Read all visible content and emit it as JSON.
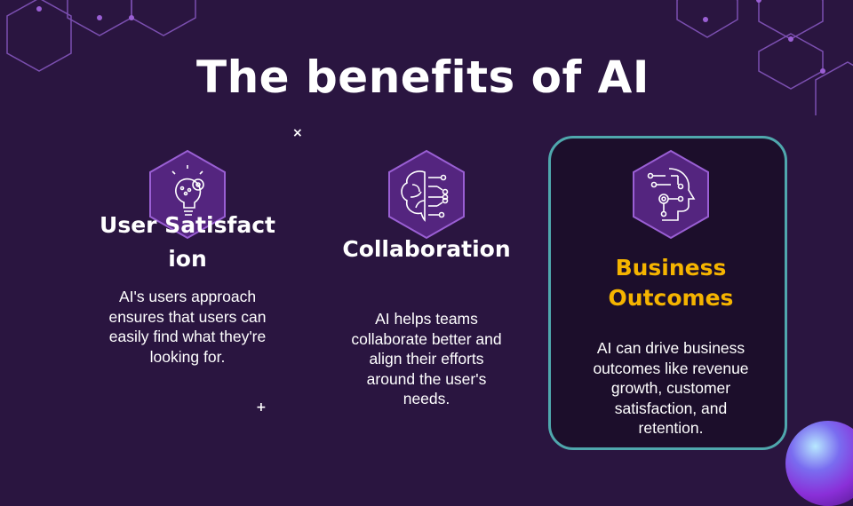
{
  "slide": {
    "title": "The benefits of AI",
    "accent_color": "#f5b400",
    "highlight_border_color": "#4fa7ad",
    "background_color": "#2a1540",
    "items": [
      {
        "heading": "User Satisfaction",
        "body": "AI's users approach ensures that users can easily find what they're looking for.",
        "icon": "lightbulb-gear-icon"
      },
      {
        "heading": "Collaboration",
        "body": "AI helps teams collaborate better and align their efforts around the user's needs.",
        "icon": "brain-circuit-icon"
      },
      {
        "heading": "Business Outcomes",
        "body": "AI can drive business outcomes like revenue growth, customer satisfaction, and retention.",
        "icon": "ai-head-icon"
      }
    ]
  }
}
